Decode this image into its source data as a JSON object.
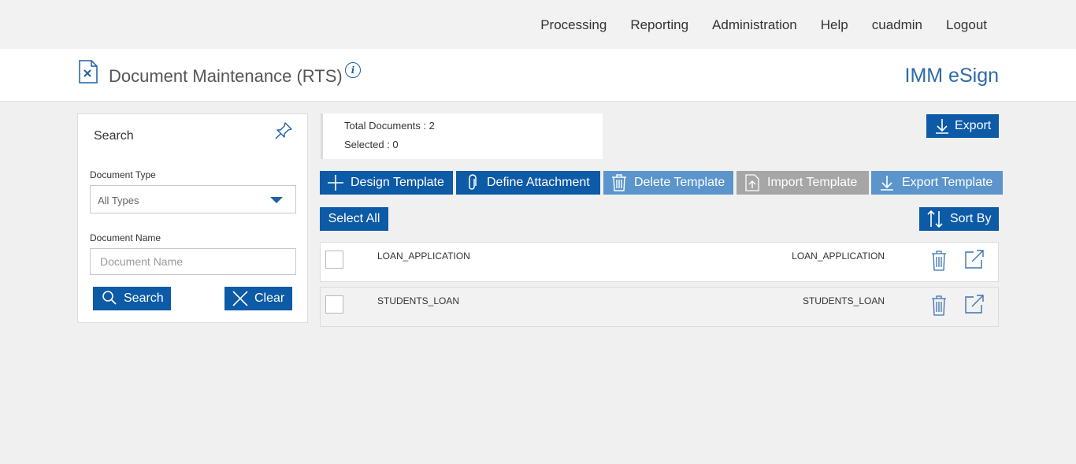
{
  "nav": {
    "items": [
      "Processing",
      "Reporting",
      "Administration",
      "Help",
      "cuadmin",
      "Logout"
    ]
  },
  "header": {
    "title": "Document Maintenance (RTS)",
    "info_glyph": "i",
    "brand": "IMM eSign"
  },
  "search": {
    "title": "Search",
    "doc_type_label": "Document Type",
    "doc_type_value": "All Types",
    "doc_name_label": "Document Name",
    "doc_name_placeholder": "Document Name",
    "search_button": "Search",
    "clear_button": "Clear"
  },
  "stats": {
    "total": "Total Documents : 2",
    "selected": "Selected : 0"
  },
  "toolbar": {
    "export": "Export",
    "design_template": "Design Template",
    "define_attachment": "Define Attachment",
    "delete_template": "Delete Template",
    "import_template": "Import Template",
    "export_template": "Export Template",
    "select_all": "Select All",
    "sort_by": "Sort By"
  },
  "documents": [
    {
      "name": "LOAN_APPLICATION",
      "name2": "LOAN_APPLICATION"
    },
    {
      "name": "STUDENTS_LOAN",
      "name2": "STUDENTS_LOAN"
    }
  ],
  "colors": {
    "primary": "#0d5aa7",
    "primary_disabled": "#5b95cb",
    "gray_disabled": "#a6a6a6",
    "brand_text": "#2d6aa7"
  }
}
